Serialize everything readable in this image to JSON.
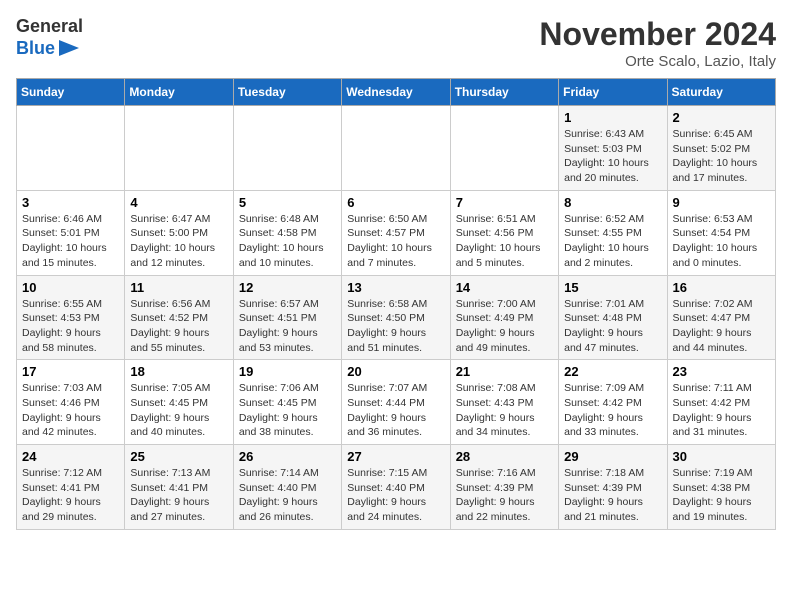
{
  "header": {
    "logo_line1": "General",
    "logo_line2": "Blue",
    "month": "November 2024",
    "location": "Orte Scalo, Lazio, Italy"
  },
  "weekdays": [
    "Sunday",
    "Monday",
    "Tuesday",
    "Wednesday",
    "Thursday",
    "Friday",
    "Saturday"
  ],
  "weeks": [
    [
      {
        "day": "",
        "info": ""
      },
      {
        "day": "",
        "info": ""
      },
      {
        "day": "",
        "info": ""
      },
      {
        "day": "",
        "info": ""
      },
      {
        "day": "",
        "info": ""
      },
      {
        "day": "1",
        "info": "Sunrise: 6:43 AM\nSunset: 5:03 PM\nDaylight: 10 hours\nand 20 minutes."
      },
      {
        "day": "2",
        "info": "Sunrise: 6:45 AM\nSunset: 5:02 PM\nDaylight: 10 hours\nand 17 minutes."
      }
    ],
    [
      {
        "day": "3",
        "info": "Sunrise: 6:46 AM\nSunset: 5:01 PM\nDaylight: 10 hours\nand 15 minutes."
      },
      {
        "day": "4",
        "info": "Sunrise: 6:47 AM\nSunset: 5:00 PM\nDaylight: 10 hours\nand 12 minutes."
      },
      {
        "day": "5",
        "info": "Sunrise: 6:48 AM\nSunset: 4:58 PM\nDaylight: 10 hours\nand 10 minutes."
      },
      {
        "day": "6",
        "info": "Sunrise: 6:50 AM\nSunset: 4:57 PM\nDaylight: 10 hours\nand 7 minutes."
      },
      {
        "day": "7",
        "info": "Sunrise: 6:51 AM\nSunset: 4:56 PM\nDaylight: 10 hours\nand 5 minutes."
      },
      {
        "day": "8",
        "info": "Sunrise: 6:52 AM\nSunset: 4:55 PM\nDaylight: 10 hours\nand 2 minutes."
      },
      {
        "day": "9",
        "info": "Sunrise: 6:53 AM\nSunset: 4:54 PM\nDaylight: 10 hours\nand 0 minutes."
      }
    ],
    [
      {
        "day": "10",
        "info": "Sunrise: 6:55 AM\nSunset: 4:53 PM\nDaylight: 9 hours\nand 58 minutes."
      },
      {
        "day": "11",
        "info": "Sunrise: 6:56 AM\nSunset: 4:52 PM\nDaylight: 9 hours\nand 55 minutes."
      },
      {
        "day": "12",
        "info": "Sunrise: 6:57 AM\nSunset: 4:51 PM\nDaylight: 9 hours\nand 53 minutes."
      },
      {
        "day": "13",
        "info": "Sunrise: 6:58 AM\nSunset: 4:50 PM\nDaylight: 9 hours\nand 51 minutes."
      },
      {
        "day": "14",
        "info": "Sunrise: 7:00 AM\nSunset: 4:49 PM\nDaylight: 9 hours\nand 49 minutes."
      },
      {
        "day": "15",
        "info": "Sunrise: 7:01 AM\nSunset: 4:48 PM\nDaylight: 9 hours\nand 47 minutes."
      },
      {
        "day": "16",
        "info": "Sunrise: 7:02 AM\nSunset: 4:47 PM\nDaylight: 9 hours\nand 44 minutes."
      }
    ],
    [
      {
        "day": "17",
        "info": "Sunrise: 7:03 AM\nSunset: 4:46 PM\nDaylight: 9 hours\nand 42 minutes."
      },
      {
        "day": "18",
        "info": "Sunrise: 7:05 AM\nSunset: 4:45 PM\nDaylight: 9 hours\nand 40 minutes."
      },
      {
        "day": "19",
        "info": "Sunrise: 7:06 AM\nSunset: 4:45 PM\nDaylight: 9 hours\nand 38 minutes."
      },
      {
        "day": "20",
        "info": "Sunrise: 7:07 AM\nSunset: 4:44 PM\nDaylight: 9 hours\nand 36 minutes."
      },
      {
        "day": "21",
        "info": "Sunrise: 7:08 AM\nSunset: 4:43 PM\nDaylight: 9 hours\nand 34 minutes."
      },
      {
        "day": "22",
        "info": "Sunrise: 7:09 AM\nSunset: 4:42 PM\nDaylight: 9 hours\nand 33 minutes."
      },
      {
        "day": "23",
        "info": "Sunrise: 7:11 AM\nSunset: 4:42 PM\nDaylight: 9 hours\nand 31 minutes."
      }
    ],
    [
      {
        "day": "24",
        "info": "Sunrise: 7:12 AM\nSunset: 4:41 PM\nDaylight: 9 hours\nand 29 minutes."
      },
      {
        "day": "25",
        "info": "Sunrise: 7:13 AM\nSunset: 4:41 PM\nDaylight: 9 hours\nand 27 minutes."
      },
      {
        "day": "26",
        "info": "Sunrise: 7:14 AM\nSunset: 4:40 PM\nDaylight: 9 hours\nand 26 minutes."
      },
      {
        "day": "27",
        "info": "Sunrise: 7:15 AM\nSunset: 4:40 PM\nDaylight: 9 hours\nand 24 minutes."
      },
      {
        "day": "28",
        "info": "Sunrise: 7:16 AM\nSunset: 4:39 PM\nDaylight: 9 hours\nand 22 minutes."
      },
      {
        "day": "29",
        "info": "Sunrise: 7:18 AM\nSunset: 4:39 PM\nDaylight: 9 hours\nand 21 minutes."
      },
      {
        "day": "30",
        "info": "Sunrise: 7:19 AM\nSunset: 4:38 PM\nDaylight: 9 hours\nand 19 minutes."
      }
    ]
  ]
}
